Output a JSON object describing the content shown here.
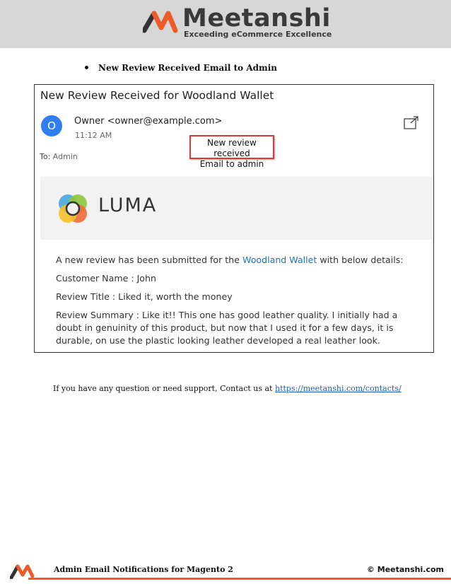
{
  "header": {
    "brand_name": "Meetanshi",
    "tagline": "Exceeding eCommerce Excellence",
    "brand_colors": {
      "accent": "#ee5b2b",
      "dark": "#3a3a3a"
    }
  },
  "section": {
    "bullet_heading": "New Review Received Email to Admin"
  },
  "email": {
    "subject": "New Review Received for Woodland Wallet",
    "avatar_letter": "O",
    "sender": "Owner <owner@example.com>",
    "time": "11:12 AM",
    "to_label": "To:",
    "to_value": "Admin",
    "callout_line1": "New review received",
    "callout_line2": "Email to admin",
    "logo_text": "LUMA",
    "intro_before": "A new review has been submitted for the",
    "product_link": "Woodland Wallet",
    "intro_after": "with below details:",
    "customer_line": "Customer Name : John",
    "title_line": "Review Title : Liked it, worth the money",
    "summary_line": "Review Summary : Like it!! This one has good leather quality. I initially had a doubt in genuinity of this product, but now that I used it for a few days, it is durable, on use the plastic looking leather developed a real leather look.",
    "icons": [
      "popout-icon",
      "luma-logo-icon"
    ]
  },
  "support": {
    "text": "If you have any question or need support, Contact us at",
    "link": "https://meetanshi.com/contacts/"
  },
  "footer": {
    "title": "Admin Email Notifications for Magento 2",
    "copyright": "© Meetanshi.com"
  }
}
